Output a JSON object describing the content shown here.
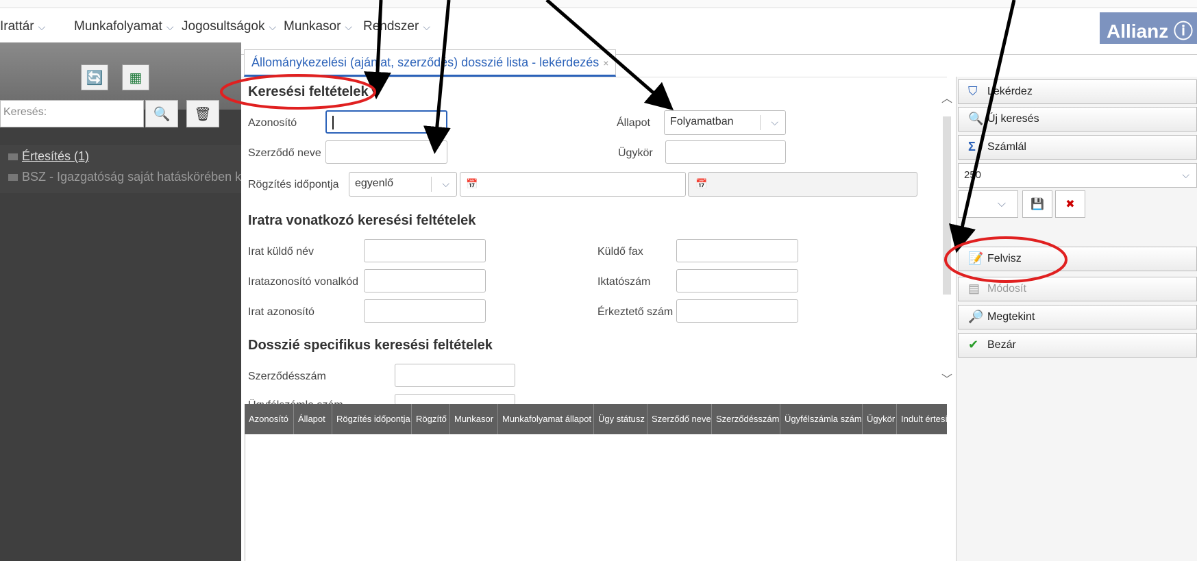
{
  "menu": {
    "items": [
      {
        "label": "Irattár"
      },
      {
        "label": "Munkafolyamat"
      },
      {
        "label": "Jogosultságok"
      },
      {
        "label": "Munkasor"
      },
      {
        "label": "Rendszer"
      }
    ],
    "chevron": "⌵",
    "logo": "Allianz"
  },
  "sidebar": {
    "search_placeholder": "Keresés:",
    "items": [
      {
        "label": "Értesítés (1)"
      },
      {
        "label": "BSZ - Igazgatóság saját hatáskörében kötö"
      }
    ]
  },
  "tab": {
    "label": "Állománykezelési (ajánlat, szerződés) dosszié lista - lekérdezés",
    "close": "×"
  },
  "form": {
    "section1": "Keresési feltételek",
    "azonosito_label": "Azonosító",
    "szerzodo_neve_label": "Szerződő neve",
    "allapot_label": "Állapot",
    "allapot_value": "Folyamatban",
    "ugykor_label": "Ügykör",
    "rogzites_label": "Rögzítés időpontja",
    "rogzites_op": "egyenlő",
    "section2": "Iratra vonatkozó keresési feltételek",
    "irat_kuldo_nev": "Irat küldő név",
    "iratazonosito_vonalkod": "Iratazonosító vonalkód",
    "irat_azonosito": "Irat azonosító",
    "kuldo_fax": "Küldő fax",
    "iktatoszam": "Iktatószám",
    "erkezteto_szam": "Érkeztető szám",
    "section3": "Dosszié specifikus keresési feltételek",
    "szerzodesszam": "Szerződésszám",
    "ugyfelszamla_szam": "Ügyfélszámla szám"
  },
  "table": {
    "columns": [
      "Azonosító",
      "Állapot",
      "Rögzítés időpontja",
      "Rögzítő",
      "Munkasor",
      "Munkafolyamat állapot",
      "Ügy státusz",
      "Szerződő neve",
      "Szerződésszám",
      "Ügyfélszámla szám",
      "Ügykör",
      "Indult értesít"
    ]
  },
  "actions": {
    "lekerdez": "Lekérdez",
    "uj_kereses": "Új keresés",
    "szamlal": "Számlál",
    "page_size": "250",
    "felvisz": "Felvisz",
    "modosit": "Módosít",
    "megtekint": "Megtekint",
    "bezar": "Bezár"
  },
  "colors": {
    "accent": "#2b62b9",
    "annotation": "#e02020"
  }
}
